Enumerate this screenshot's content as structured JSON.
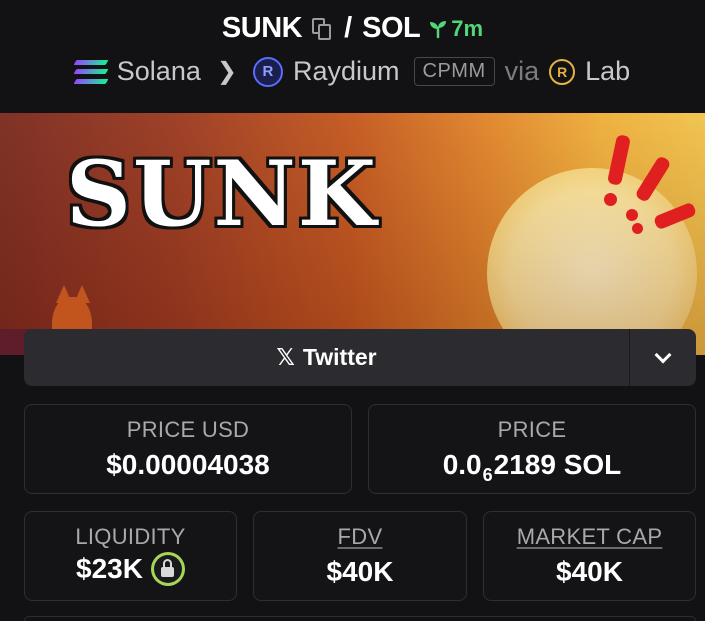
{
  "pair": {
    "base": "SUNK",
    "slash": "/",
    "quote": "SOL",
    "age": "7m",
    "icons": {
      "copy": "copy-icon",
      "age": "seedling-icon"
    }
  },
  "chain": {
    "network": "Solana",
    "dex": "Raydium",
    "dex_icon_letter": "R",
    "pool_type": "CPMM",
    "via": "via",
    "launchpad": "Lab",
    "launchpad_icon_letter": "R"
  },
  "banner": {
    "text": "SUNK"
  },
  "links": {
    "twitter_label": "Twitter",
    "x_glyph": "𝕏"
  },
  "stats": {
    "price_usd": {
      "label": "PRICE USD",
      "value": "$0.00004038"
    },
    "price": {
      "label": "PRICE",
      "prefix": "0.0",
      "zeros": "6",
      "suffix": "2189 SOL"
    },
    "liquidity": {
      "label": "LIQUIDITY",
      "value": "$23K"
    },
    "fdv": {
      "label": "FDV",
      "value": "$40K"
    },
    "market_cap": {
      "label": "MARKET CAP",
      "value": "$40K"
    }
  },
  "colors": {
    "background": "#121214",
    "card_border": "#2e2e33",
    "age_green": "#52d67a",
    "lock_green": "#a5d65a",
    "exclaim_red": "#e02020"
  }
}
